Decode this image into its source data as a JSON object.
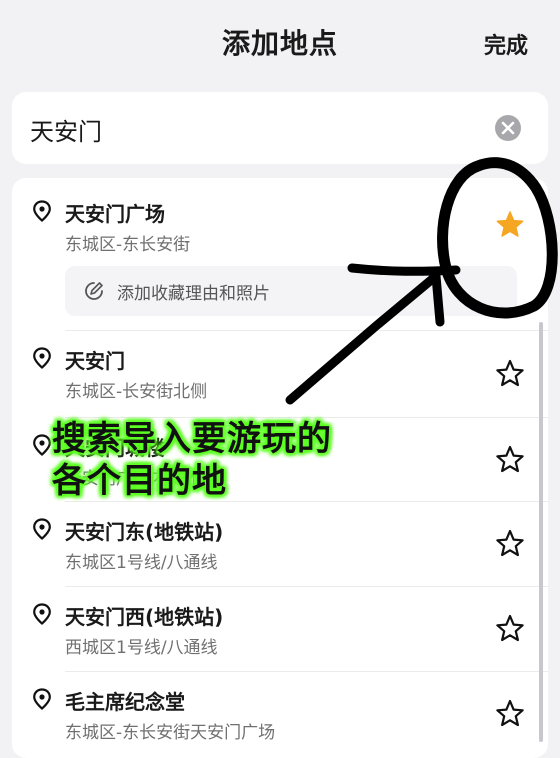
{
  "header": {
    "title": "添加地点",
    "done_label": "完成"
  },
  "search": {
    "value": "天安门",
    "clear_icon": "close-circle-icon"
  },
  "results": [
    {
      "name": "天安门广场",
      "address": "东城区-东长安街",
      "favorited": true,
      "note_label": "添加收藏理由和照片"
    },
    {
      "name": "天安门",
      "address": "东城区-长安街北侧",
      "favorited": false
    },
    {
      "name": "天安门城楼",
      "address": "天安门广场内(北侧)",
      "favorited": false
    },
    {
      "name": "天安门东(地铁站)",
      "address": "东城区1号线/八通线",
      "favorited": false
    },
    {
      "name": "天安门西(地铁站)",
      "address": "西城区1号线/八通线",
      "favorited": false
    },
    {
      "name": "毛主席纪念堂",
      "address": "东城区-东长安街天安门广场",
      "favorited": false
    }
  ],
  "annotation": {
    "line1": "搜索导入要游玩的",
    "line2": "各个目的地",
    "highlight_color": "#5cff22"
  },
  "colors": {
    "star_filled": "#f5a623",
    "background": "#f2f2f4"
  }
}
